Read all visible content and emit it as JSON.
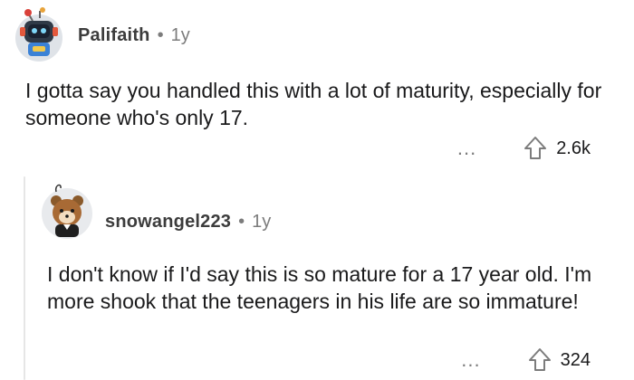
{
  "comments": [
    {
      "username": "Palifaith",
      "separator": "•",
      "age": "1y",
      "text": "I gotta say you handled this with a lot of maturity, especially for someone who's only 17.",
      "more": "...",
      "score": "2.6k",
      "avatar": "robot-avatar-icon"
    },
    {
      "username": "snowangel223",
      "separator": "•",
      "age": "1y",
      "text": "I don't know if I'd say this is so mature for a 17 year old. I'm more shook that the teenagers in his life are so immature!",
      "more": "...",
      "score": "324",
      "avatar": "bear-avatar-icon"
    }
  ],
  "icons": {
    "upvote": "upvote-arrow-icon",
    "more": "more-options-icon"
  },
  "colors": {
    "text": "#1a1a1b",
    "meta": "#7c7c7c",
    "thread_line": "#e6e6e6"
  }
}
